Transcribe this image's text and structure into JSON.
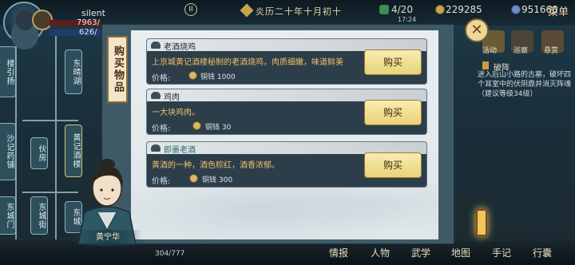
{
  "header": {
    "player_name": "silent",
    "hp": "7963/",
    "mp": "626/",
    "date": "炎历二十年十月初十",
    "action_points": "4/20",
    "clock": "17:24",
    "currency_copper": "229285",
    "currency_silver": "951660",
    "menu_label": "菜单",
    "pause_symbol": "II"
  },
  "map": {
    "nodes": [
      "楼引扬",
      "东晴湖",
      "沙记药铺",
      "伙房",
      "黄记酒楼",
      "东城门",
      "东城街",
      "东城",
      "东城"
    ]
  },
  "right_panel": {
    "icons": [
      "活动",
      "巡察",
      "悬赏"
    ],
    "quest_title": "破阵",
    "quest_text": "进入后山小路的古墓，破坏四个耳室中的伏阴鼎并消灭阵魂（建议等级34级）"
  },
  "dialog": {
    "title": "购买物品",
    "close_symbol": "✕",
    "items": [
      {
        "name": "老酒烧鸡",
        "desc": "上京城黄记酒楼秘制的老酒烧鸡，肉质细嫩，味道鲜美",
        "price_label": "价格:",
        "price": "铜钱 1000",
        "buy_label": "购买"
      },
      {
        "name": "鸡肉",
        "desc": "一大块鸡肉。",
        "price_label": "价格:",
        "price": "铜钱 30",
        "buy_label": "购买"
      },
      {
        "name": "即墨老酒",
        "desc": "黄酒的一种，酒色棕红，酒香浓郁。",
        "price_label": "价格:",
        "price": "铜钱 300",
        "buy_label": "购买"
      }
    ]
  },
  "npc": {
    "name": "黄宁华"
  },
  "footer": {
    "exp": "304/777",
    "buttons": [
      "情报",
      "人物",
      "武学",
      "地图",
      "手记",
      "行囊"
    ]
  },
  "colors": {
    "dialog_bg": "#e9edef",
    "item_bg": "#2c3e4a",
    "desc_text": "#f0c069",
    "buy_button": "#f3e398"
  }
}
